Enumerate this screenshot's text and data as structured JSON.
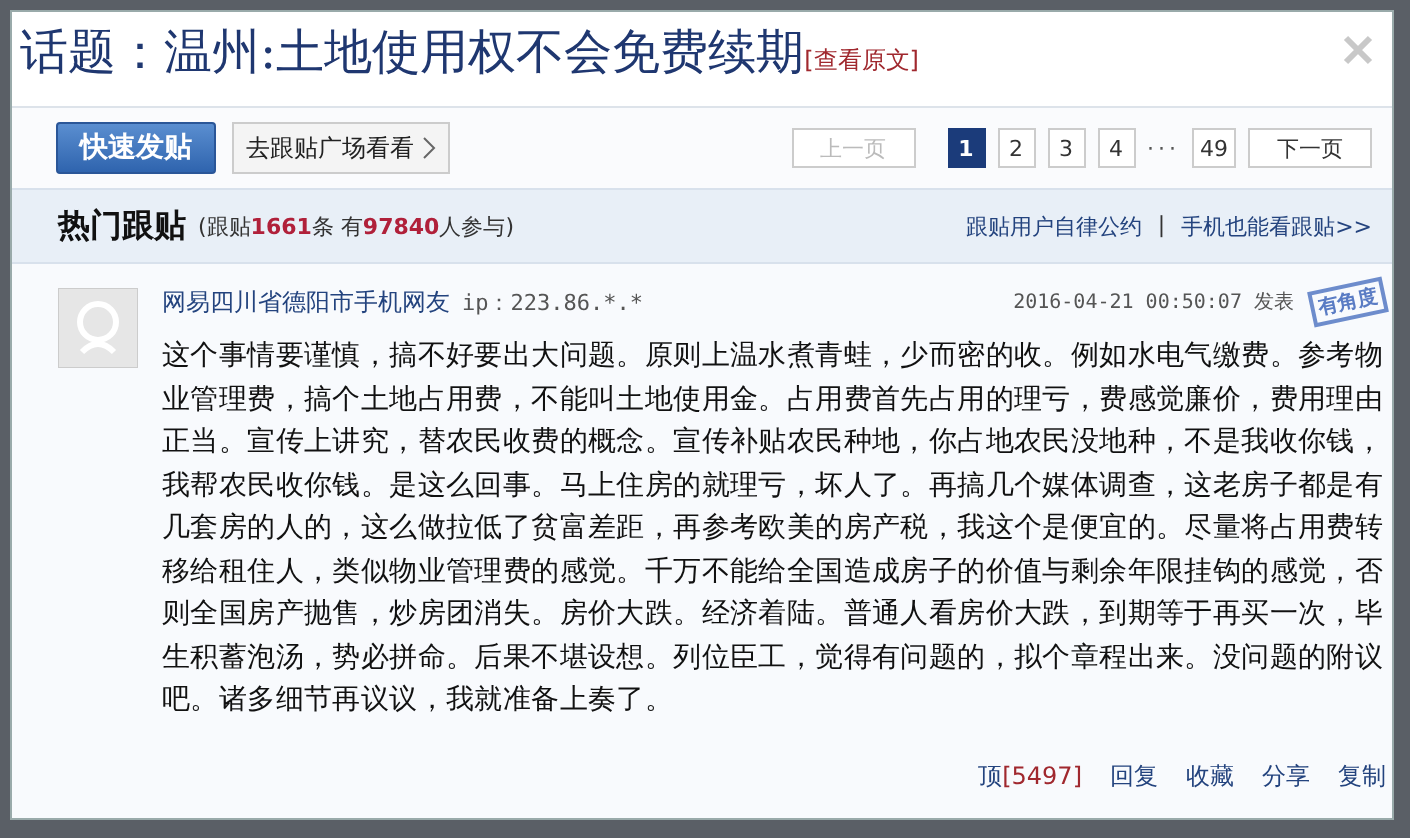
{
  "title": {
    "prefix": "话题：",
    "topic": "温州:土地使用权不会免费续期",
    "link": "[查看原文]"
  },
  "toolbar": {
    "post_button": "快速发贴",
    "plaza_button": "去跟贴广场看看"
  },
  "pagination": {
    "prev": {
      "label": "上一页",
      "disabled": true
    },
    "pages": [
      {
        "label": "1",
        "selected": true
      },
      {
        "label": "2",
        "selected": false
      },
      {
        "label": "3",
        "selected": false
      },
      {
        "label": "4",
        "selected": false
      },
      {
        "label": "···",
        "kind": "ellipsis"
      },
      {
        "label": "49",
        "selected": false
      }
    ],
    "next": {
      "label": "下一页",
      "disabled": false
    }
  },
  "section": {
    "title": "热门跟贴",
    "stats_prefix": "(跟贴",
    "count": "1661",
    "stats_mid": "条  有",
    "participants": "97840",
    "stats_suffix": "人参与)",
    "links": [
      "跟贴用户自律公约",
      "手机也能看跟贴>>"
    ],
    "separator": "|"
  },
  "post": {
    "author": "网易四川省德阳市手机网友",
    "ip": "ip：223.86.*.*",
    "time": "2016-04-21 00:50:07 发表",
    "stamp": "有角度",
    "body": "这个事情要谨慎，搞不好要出大问题。原则上温水煮青蛙，少而密的收。例如水电气缴费。参考物业管理费，搞个土地占用费，不能叫土地使用金。占用费首先占用的理亏，费感觉廉价，费用理由正当。宣传上讲究，替农民收费的概念。宣传补贴农民种地，你占地农民没地种，不是我收你钱，我帮农民收你钱。是这么回事。马上住房的就理亏，坏人了。再搞几个媒体调查，这老房子都是有几套房的人的，这么做拉低了贫富差距，再参考欧美的房产税，我这个是便宜的。尽量将占用费转移给租住人，类似物业管理费的感觉。千万不能给全国造成房子的价值与剩余年限挂钩的感觉，否则全国房产抛售，炒房团消失。房价大跌。经济着陆。普通人看房价大跌，到期等于再买一次，毕生积蓄泡汤，势必拼命。后果不堪设想。列位臣工，觉得有问题的，拟个章程出来。没问题的附议吧。诸多细节再议议，我就准备上奏了。",
    "actions": [
      {
        "label": "顶",
        "count": "[5497]"
      },
      {
        "label": "回复"
      },
      {
        "label": "收藏"
      },
      {
        "label": "分享"
      },
      {
        "label": "复制"
      }
    ]
  }
}
